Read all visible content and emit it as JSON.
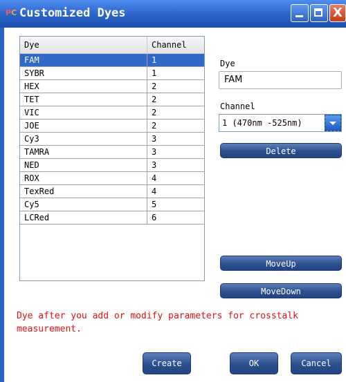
{
  "window": {
    "title": "Customized Dyes",
    "app_icon_text": "P",
    "app_icon_text2": "C",
    "minimize_glyph": "minimize-icon",
    "maximize_glyph": "maximize-icon",
    "close_glyph": "X"
  },
  "table": {
    "headers": {
      "dye": "Dye",
      "channel": "Channel"
    },
    "rows": [
      {
        "dye": "FAM",
        "channel": "1",
        "selected": true
      },
      {
        "dye": "SYBR",
        "channel": "1"
      },
      {
        "dye": "HEX",
        "channel": "2"
      },
      {
        "dye": "TET",
        "channel": "2"
      },
      {
        "dye": "VIC",
        "channel": "2"
      },
      {
        "dye": "JOE",
        "channel": "2"
      },
      {
        "dye": "Cy3",
        "channel": "3"
      },
      {
        "dye": "TAMRA",
        "channel": "3"
      },
      {
        "dye": "NED",
        "channel": "3"
      },
      {
        "dye": "ROX",
        "channel": "4"
      },
      {
        "dye": "TexRed",
        "channel": "4"
      },
      {
        "dye": "Cy5",
        "channel": "5"
      },
      {
        "dye": "LCRed",
        "channel": "6"
      }
    ]
  },
  "form": {
    "dye_label": "Dye",
    "dye_value": "FAM",
    "channel_label": "Channel",
    "channel_value": "1 (470nm -525nm)"
  },
  "buttons": {
    "delete": "Delete",
    "move_up": "MoveUp",
    "move_down": "MoveDown",
    "create": "Create",
    "ok": "OK",
    "cancel": "Cancel"
  },
  "warning": "Dye after you add or modify parameters for crosstalk measurement.",
  "colors": {
    "title_bar": "#2a63c8",
    "selected_row": "#3169c6",
    "warning_text": "#e01010",
    "button": "#2c4f8f"
  }
}
